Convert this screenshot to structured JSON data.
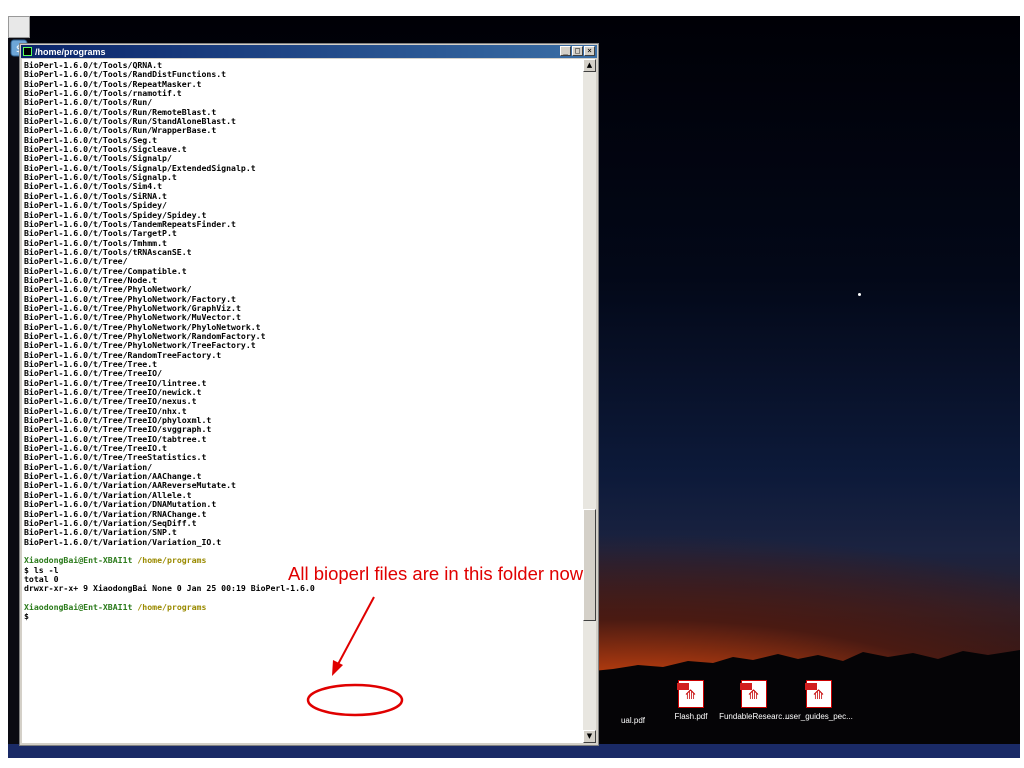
{
  "window": {
    "title": "/home/programs",
    "minimize": "_",
    "maximize": "□",
    "close": "×"
  },
  "terminal": {
    "lines": [
      {
        "text": "BioPerl-1.6.0/t/Tools/QRNA.t",
        "style": ""
      },
      {
        "text": "BioPerl-1.6.0/t/Tools/RandDistFunctions.t",
        "style": ""
      },
      {
        "text": "BioPerl-1.6.0/t/Tools/RepeatMasker.t",
        "style": ""
      },
      {
        "text": "BioPerl-1.6.0/t/Tools/rnamotif.t",
        "style": ""
      },
      {
        "text": "BioPerl-1.6.0/t/Tools/Run/",
        "style": ""
      },
      {
        "text": "BioPerl-1.6.0/t/Tools/Run/RemoteBlast.t",
        "style": ""
      },
      {
        "text": "BioPerl-1.6.0/t/Tools/Run/StandAloneBlast.t",
        "style": ""
      },
      {
        "text": "BioPerl-1.6.0/t/Tools/Run/WrapperBase.t",
        "style": ""
      },
      {
        "text": "BioPerl-1.6.0/t/Tools/Seg.t",
        "style": ""
      },
      {
        "text": "BioPerl-1.6.0/t/Tools/Sigcleave.t",
        "style": ""
      },
      {
        "text": "BioPerl-1.6.0/t/Tools/Signalp/",
        "style": ""
      },
      {
        "text": "BioPerl-1.6.0/t/Tools/Signalp/ExtendedSignalp.t",
        "style": ""
      },
      {
        "text": "BioPerl-1.6.0/t/Tools/Signalp.t",
        "style": ""
      },
      {
        "text": "BioPerl-1.6.0/t/Tools/Sim4.t",
        "style": ""
      },
      {
        "text": "BioPerl-1.6.0/t/Tools/SiRNA.t",
        "style": ""
      },
      {
        "text": "BioPerl-1.6.0/t/Tools/Spidey/",
        "style": ""
      },
      {
        "text": "BioPerl-1.6.0/t/Tools/Spidey/Spidey.t",
        "style": ""
      },
      {
        "text": "BioPerl-1.6.0/t/Tools/TandemRepeatsFinder.t",
        "style": ""
      },
      {
        "text": "BioPerl-1.6.0/t/Tools/TargetP.t",
        "style": ""
      },
      {
        "text": "BioPerl-1.6.0/t/Tools/Tmhmm.t",
        "style": ""
      },
      {
        "text": "BioPerl-1.6.0/t/Tools/tRNAscanSE.t",
        "style": ""
      },
      {
        "text": "BioPerl-1.6.0/t/Tree/",
        "style": ""
      },
      {
        "text": "BioPerl-1.6.0/t/Tree/Compatible.t",
        "style": ""
      },
      {
        "text": "BioPerl-1.6.0/t/Tree/Node.t",
        "style": ""
      },
      {
        "text": "BioPerl-1.6.0/t/Tree/PhyloNetwork/",
        "style": ""
      },
      {
        "text": "BioPerl-1.6.0/t/Tree/PhyloNetwork/Factory.t",
        "style": ""
      },
      {
        "text": "BioPerl-1.6.0/t/Tree/PhyloNetwork/GraphViz.t",
        "style": ""
      },
      {
        "text": "BioPerl-1.6.0/t/Tree/PhyloNetwork/MuVector.t",
        "style": ""
      },
      {
        "text": "BioPerl-1.6.0/t/Tree/PhyloNetwork/PhyloNetwork.t",
        "style": ""
      },
      {
        "text": "BioPerl-1.6.0/t/Tree/PhyloNetwork/RandomFactory.t",
        "style": ""
      },
      {
        "text": "BioPerl-1.6.0/t/Tree/PhyloNetwork/TreeFactory.t",
        "style": ""
      },
      {
        "text": "BioPerl-1.6.0/t/Tree/RandomTreeFactory.t",
        "style": ""
      },
      {
        "text": "BioPerl-1.6.0/t/Tree/Tree.t",
        "style": ""
      },
      {
        "text": "BioPerl-1.6.0/t/Tree/TreeIO/",
        "style": ""
      },
      {
        "text": "BioPerl-1.6.0/t/Tree/TreeIO/lintree.t",
        "style": ""
      },
      {
        "text": "BioPerl-1.6.0/t/Tree/TreeIO/newick.t",
        "style": ""
      },
      {
        "text": "BioPerl-1.6.0/t/Tree/TreeIO/nexus.t",
        "style": ""
      },
      {
        "text": "BioPerl-1.6.0/t/Tree/TreeIO/nhx.t",
        "style": ""
      },
      {
        "text": "BioPerl-1.6.0/t/Tree/TreeIO/phyloxml.t",
        "style": ""
      },
      {
        "text": "BioPerl-1.6.0/t/Tree/TreeIO/svggraph.t",
        "style": ""
      },
      {
        "text": "BioPerl-1.6.0/t/Tree/TreeIO/tabtree.t",
        "style": ""
      },
      {
        "text": "BioPerl-1.6.0/t/Tree/TreeIO.t",
        "style": ""
      },
      {
        "text": "BioPerl-1.6.0/t/Tree/TreeStatistics.t",
        "style": ""
      },
      {
        "text": "BioPerl-1.6.0/t/Variation/",
        "style": ""
      },
      {
        "text": "BioPerl-1.6.0/t/Variation/AAChange.t",
        "style": ""
      },
      {
        "text": "BioPerl-1.6.0/t/Variation/AAReverseMutate.t",
        "style": ""
      },
      {
        "text": "BioPerl-1.6.0/t/Variation/Allele.t",
        "style": ""
      },
      {
        "text": "BioPerl-1.6.0/t/Variation/DNAMutation.t",
        "style": ""
      },
      {
        "text": "BioPerl-1.6.0/t/Variation/RNAChange.t",
        "style": ""
      },
      {
        "text": "BioPerl-1.6.0/t/Variation/SeqDiff.t",
        "style": ""
      },
      {
        "text": "BioPerl-1.6.0/t/Variation/SNP.t",
        "style": ""
      },
      {
        "text": "BioPerl-1.6.0/t/Variation/Variation_IO.t",
        "style": ""
      },
      {
        "text": "",
        "style": ""
      },
      {
        "text": "XiaodongBai@Ent-XBAI1t /home/programs",
        "style": "prompt"
      },
      {
        "text": "$ ls -l",
        "style": ""
      },
      {
        "text": "total 0",
        "style": ""
      },
      {
        "text": "drwxr-xr-x+ 9 XiaodongBai None 0 Jan 25 00:19 BioPerl-1.6.0",
        "style": ""
      },
      {
        "text": "",
        "style": ""
      },
      {
        "text": "XiaodongBai@Ent-XBAI1t /home/programs",
        "style": "prompt"
      },
      {
        "text": "$",
        "style": ""
      }
    ]
  },
  "scrollbar": {
    "up": "▲",
    "down": "▼",
    "thumb_position": 0.8
  },
  "annotation": {
    "text": "All bioperl files are in this folder now",
    "color": "#e00000"
  },
  "desktop": {
    "files": [
      {
        "label": "ual.pdf",
        "icon": "pdf-icon"
      },
      {
        "label": "Flash.pdf",
        "icon": "pdf-icon"
      },
      {
        "label": "FundableResearc...",
        "icon": "pdf-icon"
      },
      {
        "label": "user_guides_pec...",
        "icon": "pdf-icon"
      }
    ]
  }
}
